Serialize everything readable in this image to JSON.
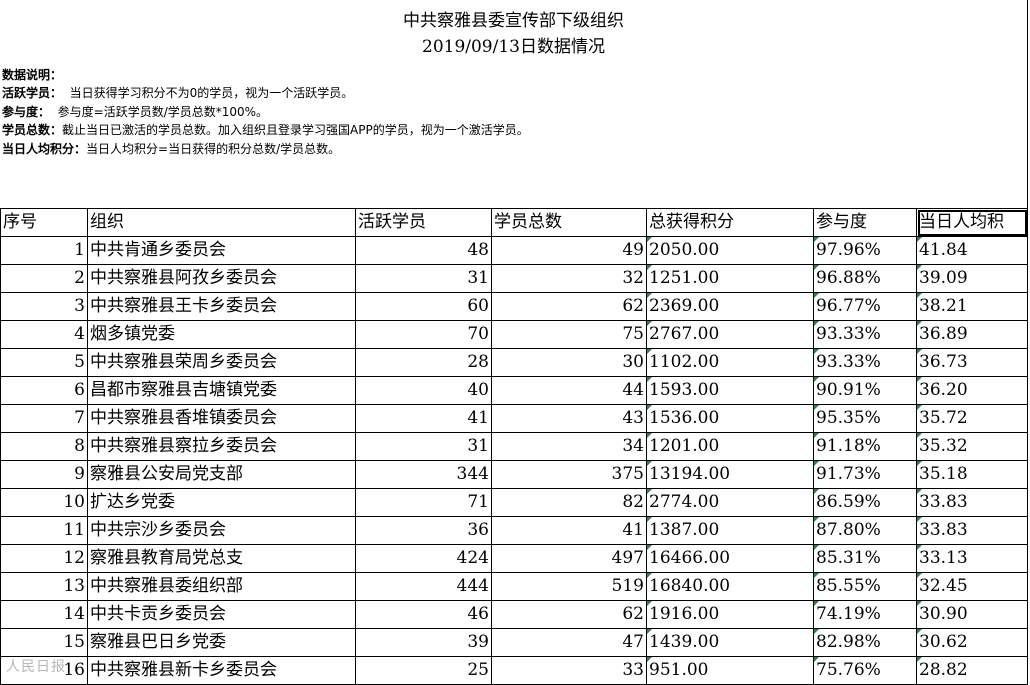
{
  "title_line1": "中共察雅县委宣传部下级组织",
  "title_line2": "2019/09/13日数据情况",
  "notes": {
    "heading": "数据说明：",
    "active_label": "活跃学员：",
    "active_text": "当日获得学习积分不为0的学员，视为一个活跃学员。",
    "participation_label": "参与度：",
    "participation_text": "参与度=活跃学员数/学员总数*100%。",
    "total_label": "学员总数：",
    "total_text": "截止当日已激活的学员总数。加入组织且登录学习强国APP的学员，视为一个激活学员。",
    "avg_label": "当日人均积分：",
    "avg_text": "当日人均积分=当日获得的积分总数/学员总数。"
  },
  "columns": [
    "序号",
    "组织",
    "活跃学员",
    "学员总数",
    "总获得积分",
    "参与度",
    "当日人均积"
  ],
  "rows": [
    [
      "1",
      "中共肯通乡委员会",
      "48",
      "49",
      "2050.00",
      "97.96%",
      "41.84"
    ],
    [
      "2",
      "中共察雅县阿孜乡委员会",
      "31",
      "32",
      "1251.00",
      "96.88%",
      "39.09"
    ],
    [
      "3",
      "中共察雅县王卡乡委员会",
      "60",
      "62",
      "2369.00",
      "96.77%",
      "38.21"
    ],
    [
      "4",
      "烟多镇党委",
      "70",
      "75",
      "2767.00",
      "93.33%",
      "36.89"
    ],
    [
      "5",
      "中共察雅县荣周乡委员会",
      "28",
      "30",
      "1102.00",
      "93.33%",
      "36.73"
    ],
    [
      "6",
      "昌都市察雅县吉塘镇党委",
      "40",
      "44",
      "1593.00",
      "90.91%",
      "36.20"
    ],
    [
      "7",
      "中共察雅县香堆镇委员会",
      "41",
      "43",
      "1536.00",
      "95.35%",
      "35.72"
    ],
    [
      "8",
      "中共察雅县察拉乡委员会",
      "31",
      "34",
      "1201.00",
      "91.18%",
      "35.32"
    ],
    [
      "9",
      "察雅县公安局党支部",
      "344",
      "375",
      "13194.00",
      "91.73%",
      "35.18"
    ],
    [
      "10",
      "扩达乡党委",
      "71",
      "82",
      "2774.00",
      "86.59%",
      "33.83"
    ],
    [
      "11",
      "中共宗沙乡委员会",
      "36",
      "41",
      "1387.00",
      "87.80%",
      "33.83"
    ],
    [
      "12",
      "察雅县教育局党总支",
      "424",
      "497",
      "16466.00",
      "85.31%",
      "33.13"
    ],
    [
      "13",
      "中共察雅县委组织部",
      "444",
      "519",
      "16840.00",
      "85.55%",
      "32.45"
    ],
    [
      "14",
      "中共卡贡乡委员会",
      "46",
      "62",
      "1916.00",
      "74.19%",
      "30.90"
    ],
    [
      "15",
      "察雅县巴日乡党委",
      "39",
      "47",
      "1439.00",
      "82.98%",
      "30.62"
    ],
    [
      "16",
      "中共察雅县新卡乡委员会",
      "25",
      "33",
      "951.00",
      "75.76%",
      "28.82"
    ]
  ],
  "watermark": "人民日报"
}
